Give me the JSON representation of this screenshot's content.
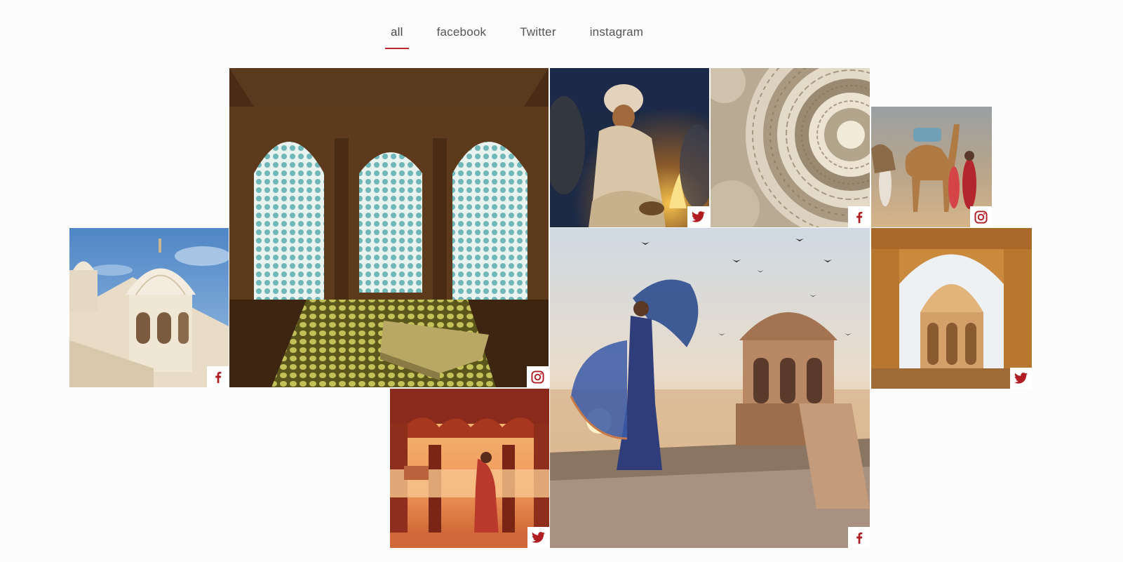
{
  "filters": {
    "tabs": [
      {
        "label": "all",
        "active": true
      },
      {
        "label": "facebook",
        "active": false
      },
      {
        "label": "Twitter",
        "active": false
      },
      {
        "label": "instagram",
        "active": false
      }
    ]
  },
  "gallery": {
    "items": [
      {
        "subject": "white domed palace pavilion against blue sky",
        "source": "facebook",
        "icon": "facebook-icon"
      },
      {
        "subject": "latticed stone jali arch windows over a lake",
        "source": "instagram",
        "icon": "instagram-icon"
      },
      {
        "subject": "turbaned man by a campfire at night",
        "source": "twitter",
        "icon": "twitter-icon"
      },
      {
        "subject": "carved stone ceiling ornament",
        "source": "facebook",
        "icon": "facebook-icon"
      },
      {
        "subject": "people with camels in the desert",
        "source": "instagram",
        "icon": "instagram-icon"
      },
      {
        "subject": "woman with flowing scarf by a lakeside pavilion",
        "source": "facebook",
        "icon": "facebook-icon"
      },
      {
        "subject": "golden sandstone chhatri through an arch",
        "source": "twitter",
        "icon": "twitter-icon"
      },
      {
        "subject": "woman in red standing under a scalloped arch by the lake",
        "source": "twitter",
        "icon": "twitter-icon"
      }
    ]
  },
  "colors": {
    "accent": "#c0272d",
    "icon": "#b01e23",
    "background": "#fcfcfc"
  }
}
